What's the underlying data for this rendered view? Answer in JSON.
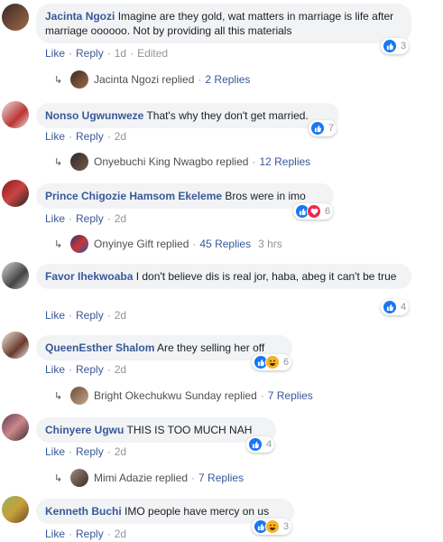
{
  "comments": [
    {
      "name": "Jacinta Ngozi",
      "text": "Imagine are they gold, wat matters in marriage is life after marriage oooooo. Not by providing all this materials",
      "actions": {
        "like": "Like",
        "reply": "Reply",
        "time": "1d",
        "extra": "Edited"
      },
      "reactions": {
        "count": "3",
        "types": [
          "like-icon"
        ]
      },
      "reply": {
        "text": "Jacinta Ngozi replied",
        "count": "2 Replies"
      }
    },
    {
      "name": "Nonso Ugwunweze",
      "text": "That's why they don't get married.",
      "actions": {
        "like": "Like",
        "reply": "Reply",
        "time": "2d"
      },
      "reactions": {
        "count": "7",
        "types": [
          "like-icon"
        ]
      },
      "reply": {
        "text": "Onyebuchi King Nwagbo replied",
        "count": "12 Replies"
      }
    },
    {
      "name": "Prince Chigozie Hamsom Ekeleme",
      "text": "Bros were in imo",
      "actions": {
        "like": "Like",
        "reply": "Reply",
        "time": "2d"
      },
      "reactions": {
        "count": "6",
        "types": [
          "like-icon",
          "love-icon"
        ]
      },
      "reply": {
        "text": "Onyinye Gift replied",
        "count": "45 Replies",
        "time": "3 hrs"
      }
    },
    {
      "name": "Favor Ihekwoaba",
      "text": "I don't believe dis is real jor, haba, abeg it can't be true",
      "actions": {
        "like": "Like",
        "reply": "Reply",
        "time": "2d"
      },
      "reactions": {
        "count": "4",
        "types": [
          "like-icon"
        ]
      }
    },
    {
      "name": "QueenEsther Shalom",
      "text": "Are they selling her off",
      "actions": {
        "like": "Like",
        "reply": "Reply",
        "time": "2d"
      },
      "reactions": {
        "count": "6",
        "types": [
          "like-icon",
          "haha-icon"
        ]
      },
      "reply": {
        "text": "Bright Okechukwu Sunday replied",
        "count": "7 Replies"
      }
    },
    {
      "name": "Chinyere Ugwu",
      "text": "THIS IS TOO MUCH NAH",
      "actions": {
        "like": "Like",
        "reply": "Reply",
        "time": "2d"
      },
      "reactions": {
        "count": "4",
        "types": [
          "like-icon"
        ]
      },
      "reply": {
        "text": "Mimi Adazie replied",
        "count": "7 Replies"
      }
    },
    {
      "name": "Kenneth Buchi",
      "text": "IMO people have mercy on us",
      "actions": {
        "like": "Like",
        "reply": "Reply",
        "time": "2d"
      },
      "reactions": {
        "count": "3",
        "types": [
          "like-icon",
          "haha-icon"
        ]
      }
    }
  ],
  "separator": "·",
  "colors": {
    "link": "#385898",
    "bubble": "#f2f3f5",
    "like": "#1877f2",
    "love": "#f0284a",
    "haha": "#f7b125"
  }
}
